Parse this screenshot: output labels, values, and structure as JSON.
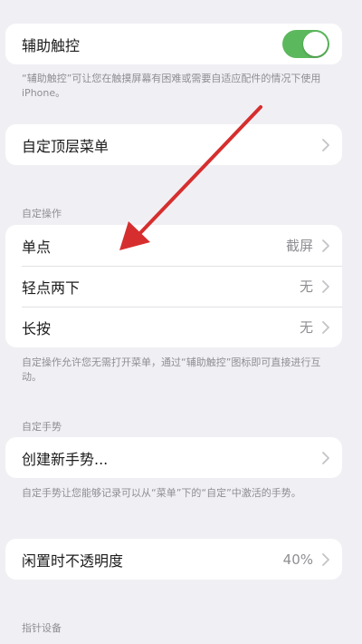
{
  "assistive_touch": {
    "label": "辅助触控",
    "toggle_on": true,
    "note": "“辅助触控”可让您在触摸屏幕有困难或需要自适应配件的情况下使用iPhone。"
  },
  "top_menu": {
    "label": "自定顶层菜单"
  },
  "custom_actions": {
    "header": "自定操作",
    "items": [
      {
        "label": "单点",
        "value": "截屏"
      },
      {
        "label": "轻点两下",
        "value": "无"
      },
      {
        "label": "长按",
        "value": "无"
      }
    ],
    "note": "自定操作允许您无需打开菜单，通过“辅助触控”图标即可直接进行互动。"
  },
  "custom_gestures": {
    "header": "自定手势",
    "create_label": "创建新手势...",
    "note": "自定手势让您能够记录可以从“菜单”下的“自定”中激活的手势。"
  },
  "idle_opacity": {
    "label": "闲置时不透明度",
    "value": "40%"
  },
  "pointer_devices": {
    "header": "指针设备"
  },
  "colors": {
    "toggle_on": "#5cb85c",
    "annotation_arrow": "#d62e2e",
    "background": "#f0f0f4"
  },
  "icons": {
    "chevron": "chevron-right-icon",
    "annotation": "red-arrow-annotation"
  }
}
